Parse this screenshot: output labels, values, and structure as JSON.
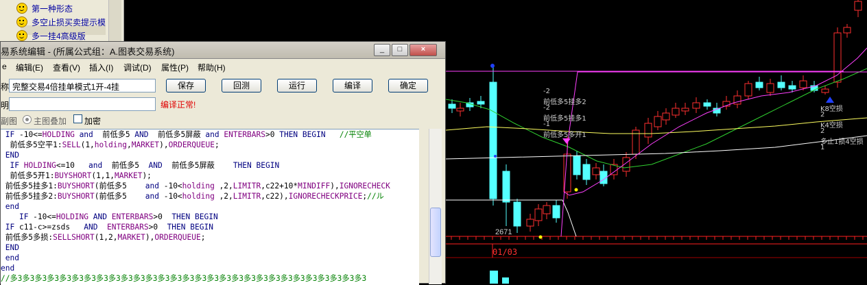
{
  "tree": {
    "items": [
      {
        "label": "第一种形态"
      },
      {
        "label": "多空止损买卖提示模"
      },
      {
        "label": "多一挂4高级版"
      }
    ]
  },
  "window": {
    "title": "易系统编辑 - (所属公式组：A.图表交易系统)",
    "controls": [
      "_",
      "□",
      "×"
    ]
  },
  "menu": [
    "编辑(E)",
    "查看(V)",
    "插入(I)",
    "调试(D)",
    "属性(P)",
    "帮助(H)"
  ],
  "form": {
    "name_label": "称:",
    "name_value": "完整交易4倍挂单模式1开-4挂",
    "desc_label": "明:",
    "status": "编译正常!",
    "mode_label": "副图",
    "radio_label": "主图叠加",
    "checkbox_label": "加密",
    "buttons": [
      "保存",
      "回测",
      "运行",
      "编译",
      "确定"
    ]
  },
  "code_lines": [
    " IF -10<=HOLDING and  前低多5 AND  前低多5屏蔽 and ENTERBARS>0 THEN BEGIN   //平空单",
    "  前低多5空平1:SELL(1,holding,MARKET),ORDERQUEUE;",
    " END",
    "  IF HOLDING<=10   and  前低多5  AND  前低多5屏蔽    THEN BEGIN",
    "  前低多5开1:BUYSHORT(1,1,MARKET);",
    " 前低多5挂多1:BUYSHORT(前低多5    and -10<holding ,2,LIMITR,c22+10*MINDIFF),IGNORECHECK",
    " 前低多5挂多2:BUYSHORT(前低多5    and -10<holding ,2,LIMITR,c22),IGNORECHECKPRICE;//ル",
    " end",
    "    IF -10<=HOLDING AND ENTERBARS>0  THEN BEGIN",
    " IF c11-c>=zsds   AND  ENTERBARS>0  THEN BEGIN",
    " 前低多5多损:SELLSHORT(1,2,MARKET),ORDERQUEUE;",
    " END",
    " end",
    "end",
    "//多3多3多3多3多3多3多3多3多3多3多3多3多3多3多3多3多3多3多3多3多3多3多3多3多3多3多3多3多3"
  ],
  "chart": {
    "annotations": [
      "-2",
      "前低多5挂多2",
      "-2",
      "前低多5挂多1",
      "-1",
      "前低多5多开1"
    ],
    "right_annotations": [
      "K8空损",
      "2",
      "K4空损",
      "2",
      "多止1损4空损",
      "1"
    ],
    "low_value": "2671",
    "date_label": "01/03",
    "colors": {
      "up": "#ff3030",
      "down": "#54ffff",
      "ma_magenta": "#ff40ff",
      "ma_yellow": "#ffff60",
      "ma_green": "#30d030",
      "ma_white": "#ffffff"
    }
  }
}
